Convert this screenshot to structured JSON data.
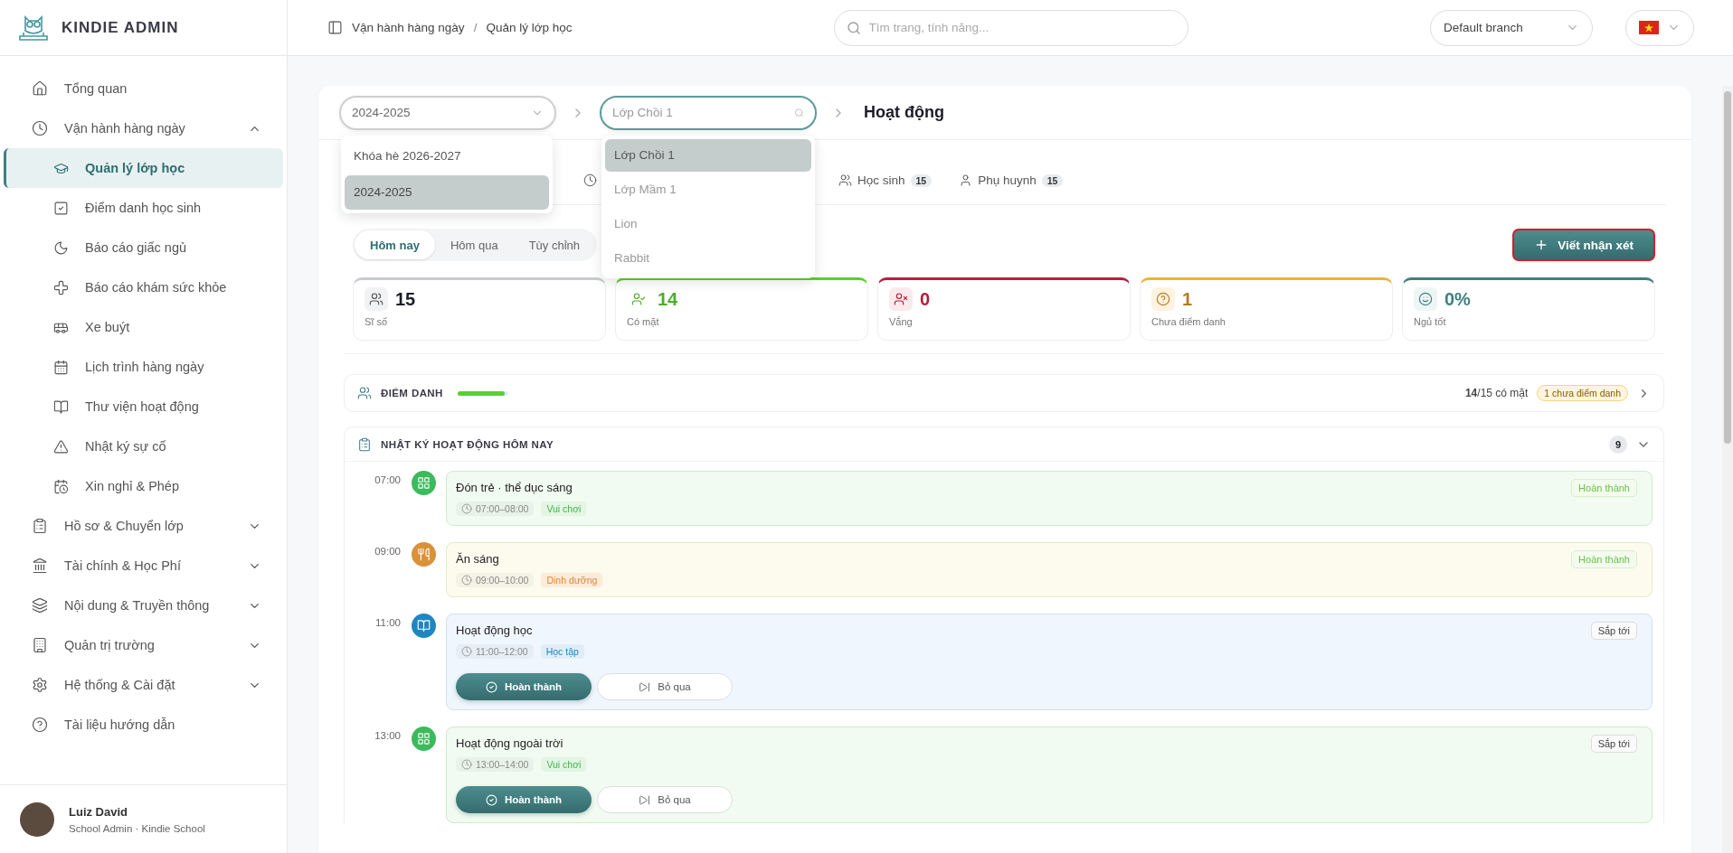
{
  "app": {
    "title": "KINDIE ADMIN"
  },
  "sidebar": {
    "items": [
      {
        "label": "Tổng quan",
        "selected": false
      },
      {
        "label": "Vận hành hàng ngày",
        "selected": false,
        "expanded": true,
        "children": [
          {
            "label": "Quản lý lớp học",
            "selected": true
          },
          {
            "label": "Điểm danh học sinh",
            "selected": false
          },
          {
            "label": "Báo cáo giấc ngủ",
            "selected": false
          },
          {
            "label": "Báo cáo khám sức khỏe",
            "selected": false
          },
          {
            "label": "Xe buýt",
            "selected": false
          },
          {
            "label": "Lịch trình hàng ngày",
            "selected": false
          },
          {
            "label": "Thư viện hoạt động",
            "selected": false
          },
          {
            "label": "Nhật ký sự cố",
            "selected": false
          },
          {
            "label": "Xin nghỉ & Phép",
            "selected": false
          }
        ]
      },
      {
        "label": "Hồ sơ & Chuyển lớp",
        "selected": false,
        "expanded": false
      },
      {
        "label": "Tài chính & Học Phí",
        "selected": false,
        "expanded": false
      },
      {
        "label": "Nội dung & Truyền thông",
        "selected": false,
        "expanded": false
      },
      {
        "label": "Quản trị trường",
        "selected": false,
        "expanded": false
      },
      {
        "label": "Hệ thống & Cài đặt",
        "selected": false,
        "expanded": false
      },
      {
        "label": "Tài liệu hướng dẫn",
        "selected": false
      }
    ],
    "user": {
      "name": "Luiz David",
      "role": "School Admin · Kindie School"
    }
  },
  "header": {
    "breadcrumb": [
      "Vận hành hàng ngày",
      "Quản lý lớp học"
    ],
    "breadcrumb_separator": "/",
    "search": {
      "placeholder": "Tìm trang, tính năng..."
    },
    "branch": "Default branch"
  },
  "year_select": {
    "value": "2024-2025",
    "options": [
      {
        "label": "Khóa hè 2026-2027",
        "selected": false
      },
      {
        "label": "2024-2025",
        "selected": true
      }
    ]
  },
  "class_select": {
    "placeholder": "Lớp Chồi 1",
    "options": [
      {
        "label": "Lớp Chồi 1",
        "selected": true
      },
      {
        "label": "Lớp Mầm 1",
        "selected": false
      },
      {
        "label": "Lion",
        "selected": false
      },
      {
        "label": "Rabbit",
        "selected": false
      }
    ]
  },
  "page_title": "Hoạt động",
  "tabs": [
    {
      "selected": false
    },
    {
      "label": "Học sinh",
      "count": "15",
      "selected": false
    },
    {
      "label": "Phụ huynh",
      "count": "15",
      "selected": false
    }
  ],
  "period_tabs": [
    {
      "label": "Hôm nay",
      "selected": true
    },
    {
      "label": "Hôm qua",
      "selected": false
    },
    {
      "label": "Tùy chỉnh",
      "selected": false
    }
  ],
  "add_button": "Viết nhận xét",
  "stats": [
    {
      "kind": "total",
      "value": "15",
      "label": "Sĩ số"
    },
    {
      "kind": "present",
      "value": "14",
      "label": "Có mặt"
    },
    {
      "kind": "absent",
      "value": "0",
      "label": "Vắng"
    },
    {
      "kind": "pending",
      "value": "1",
      "label": "Chưa điểm danh"
    },
    {
      "kind": "sleep",
      "value": "0%",
      "label": "Ngủ tốt"
    }
  ],
  "attendance": {
    "title": "ĐIỂM DANH",
    "level": 0.93,
    "summary": "**14**/15 có mặt",
    "badge": "1 chưa điểm danh"
  },
  "activity_log": {
    "title": "NHẬT KÝ HOẠT ĐỘNG HÔM NAY",
    "count": "9",
    "items": [
      {
        "kind": "play",
        "time": "07:00",
        "title": "Đón trẻ · thể dục sáng",
        "range": "07:00–08:00",
        "category": "Vui chơi",
        "status": {
          "kind": "done",
          "label": "Hoàn thành"
        }
      },
      {
        "kind": "meal",
        "time": "09:00",
        "title": "Ăn sáng",
        "range": "09:00–10:00",
        "category": "Dinh dưỡng",
        "status": {
          "kind": "done",
          "label": "Hoàn thành"
        }
      },
      {
        "kind": "study",
        "time": "11:00",
        "title": "Hoạt động học",
        "range": "11:00–12:00",
        "category": "Học tập",
        "status": {
          "kind": "upcoming",
          "label": "Sắp tới"
        },
        "actions": [
          "Hoàn thành",
          "Bỏ qua"
        ]
      },
      {
        "kind": "play",
        "time": "13:00",
        "title": "Hoạt động ngoài trời",
        "range": "13:00–14:00",
        "category": "Vui chơi",
        "status": {
          "kind": "upcoming",
          "label": "Sắp tới"
        },
        "actions": [
          "Hoàn thành",
          "Bỏ qua"
        ]
      }
    ]
  }
}
